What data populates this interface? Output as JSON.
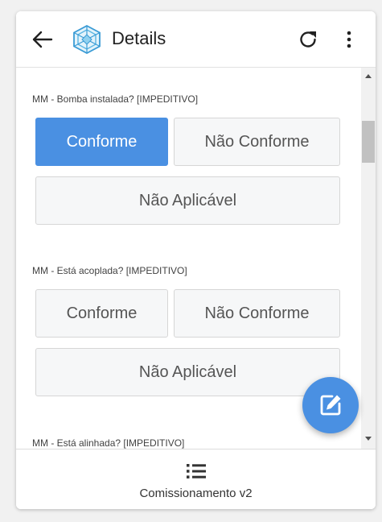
{
  "header": {
    "title": "Details",
    "back_icon": "arrow-left-icon",
    "logo_icon": "hexagon-logo-icon",
    "refresh_icon": "refresh-icon",
    "more_icon": "more-vertical-icon"
  },
  "sections": [
    {
      "label": "MM - Bomba instalada? [IMPEDITIVO]",
      "options": [
        "Conforme",
        "Não Conforme",
        "Não Aplicável"
      ],
      "selected": "Conforme"
    },
    {
      "label": "MM - Está acoplada? [IMPEDITIVO]",
      "options": [
        "Conforme",
        "Não Conforme",
        "Não Aplicável"
      ],
      "selected": null
    },
    {
      "label": "MM - Está alinhada? [IMPEDITIVO]",
      "options": [],
      "selected": null
    }
  ],
  "fab": {
    "icon": "edit-icon"
  },
  "footer": {
    "icon": "list-icon",
    "label": "Comissionamento v2"
  },
  "colors": {
    "accent": "#4a90e2",
    "option_bg": "#f6f7f8",
    "option_border": "#d6d6d6"
  }
}
